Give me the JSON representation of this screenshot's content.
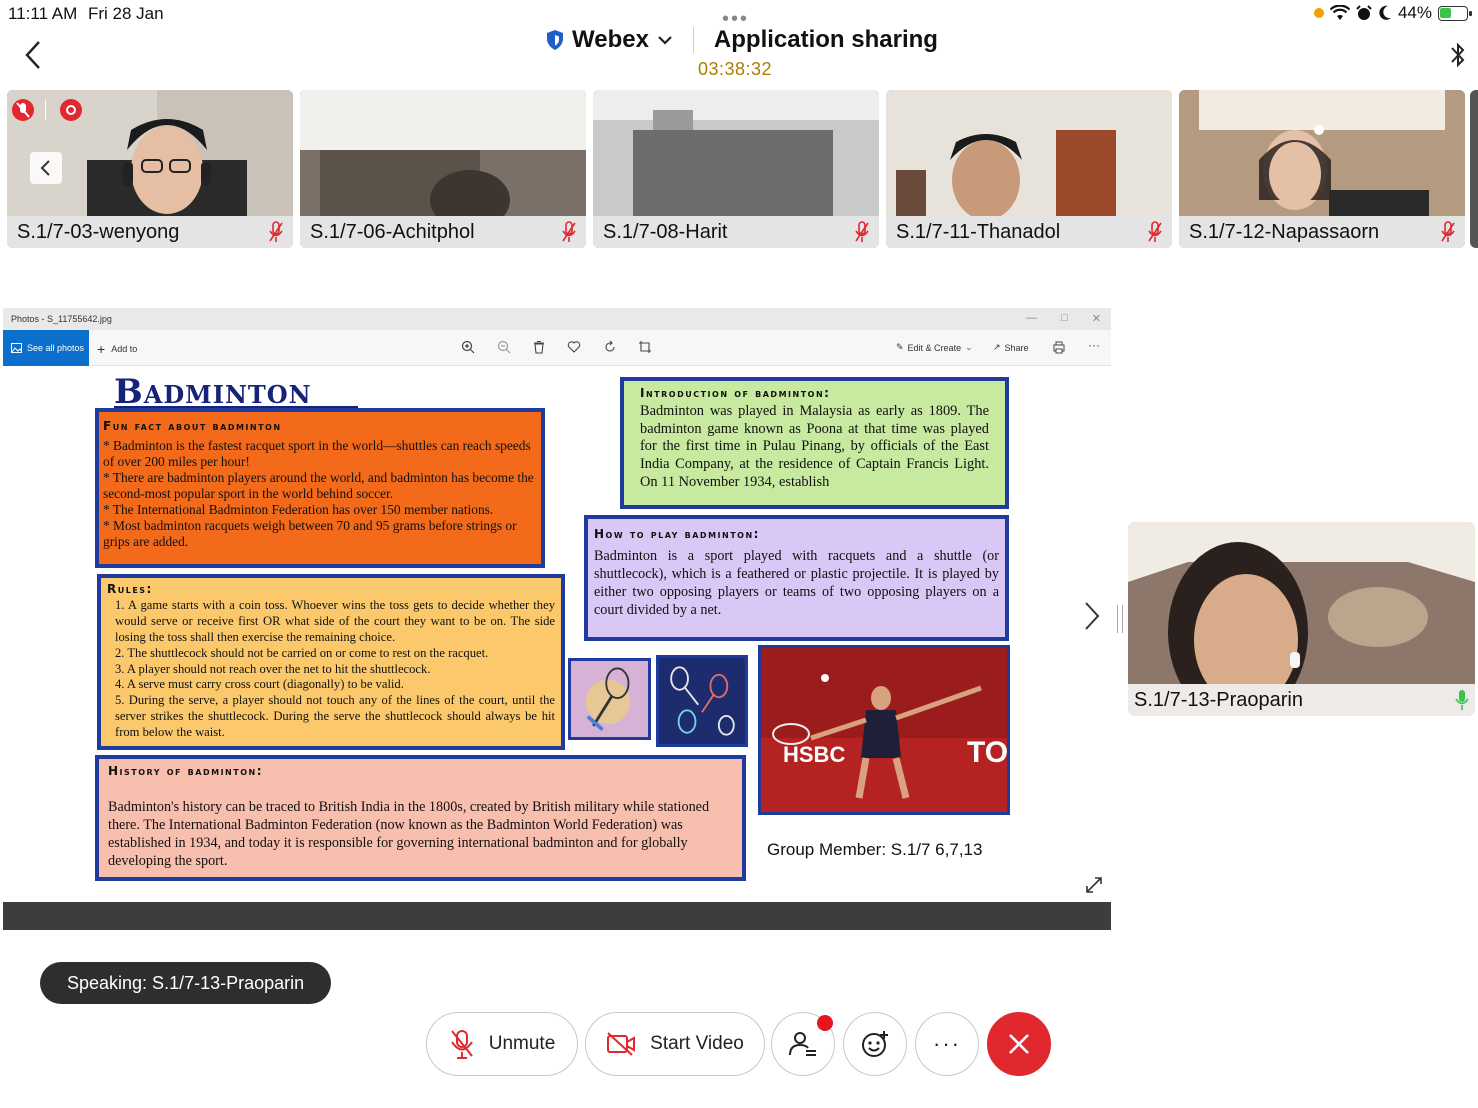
{
  "status_bar": {
    "time": "11:11 AM",
    "date": "Fri 28 Jan",
    "battery": "44%",
    "battery_level": 0.44
  },
  "header": {
    "dots": "•••",
    "app_name": "Webex",
    "title": "Application sharing",
    "timer": "03:38:32"
  },
  "participants": [
    {
      "name": "S.1/7-03-wenyong"
    },
    {
      "name": "S.1/7-06-Achitphol"
    },
    {
      "name": "S.1/7-08-Harit"
    },
    {
      "name": "S.1/7-11-Thanadol"
    },
    {
      "name": "S.1/7-12-Napassaorn"
    }
  ],
  "shared_window": {
    "title": "Photos - S_11755642.jpg",
    "see_all": "See all photos",
    "add_to": "Add to",
    "edit_create": "Edit & Create",
    "share": "Share",
    "more": "···"
  },
  "poster": {
    "title": "Badminton",
    "fun_fact": {
      "heading": "Fun fact about badminton",
      "lines": [
        "* Badminton is the fastest racquet sport in the world—shuttles can reach speeds of over 200 miles per hour!",
        "* There are badminton players around the world, and badminton has become the second-most popular sport in the world behind soccer.",
        "* The International Badminton Federation has over 150 member nations.",
        "* Most badminton racquets weigh between 70 and 95 grams before strings or grips are added."
      ]
    },
    "intro": {
      "heading": "Introduction of badminton:",
      "text": "Badminton was played in Malaysia as early as 1809. The badminton game known as Poona at that time was played for the first time in Pulau Pinang, by officials of the East India Company, at the residence of Captain Francis Light. On 11 November 1934, establish"
    },
    "how_to_play": {
      "heading": "How to play badminton:",
      "text": "Badminton is a sport played with racquets and a shuttle (or shuttlecock), which is a feathered or plastic projectile. It is played by either two opposing players or teams of two opposing players on a court divided by a net."
    },
    "rules": {
      "heading": "Rules:",
      "lines": [
        "1. A game starts with a coin toss. Whoever wins the toss gets to decide whether they would serve or receive first OR what side of the court they want to be on. The side losing the toss shall then exercise the remaining choice.",
        "2. The shuttlecock should not be carried on or come to rest on the racquet.",
        "3. A player should not reach over the net to hit the shuttlecock.",
        "4. A serve must carry cross court (diagonally) to be valid.",
        "5. During the serve, a player should not touch any of the lines of the court, until the server strikes the shuttlecock. During the serve the shuttlecock should always be hit from below the waist."
      ]
    },
    "history": {
      "heading": "History of badminton:",
      "text": "Badminton's history can be traced to British India in the 1800s, created by British military while stationed there. The International Badminton Federation (now known as the Badminton World Federation) was established in 1934, and today it is responsible for governing international badminton and for globally developing the sport."
    },
    "photo_banner_left": "HSBC",
    "photo_banner_right": "TO",
    "group_member": "Group Member: S.1/7  6,7,13"
  },
  "active_speaker": {
    "name": "S.1/7-13-Praoparin"
  },
  "speaking_pill": "Speaking: S.1/7-13-Praoparin",
  "controls": {
    "unmute": "Unmute",
    "start_video": "Start Video",
    "more": "···"
  },
  "colors": {
    "accent_red": "#e0282e",
    "poster_border": "#1f3b9e",
    "fun_fact_bg": "#f26a1a",
    "intro_bg": "#c8e9a0",
    "how_bg": "#d9c8f5",
    "rules_bg": "#fbc96b",
    "history_bg": "#f9bfae"
  }
}
